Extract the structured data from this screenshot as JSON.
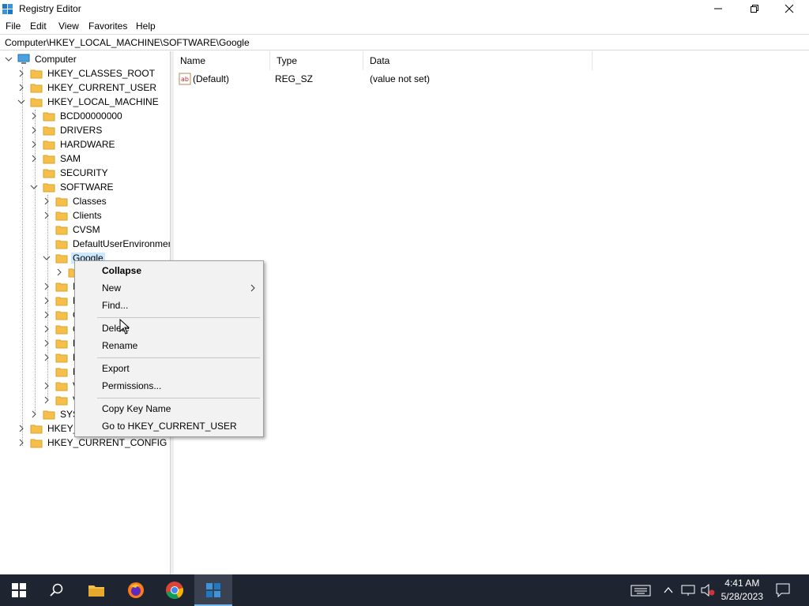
{
  "window": {
    "title": "Registry Editor"
  },
  "menu": [
    "File",
    "Edit",
    "View",
    "Favorites",
    "Help"
  ],
  "address": "Computer\\HKEY_LOCAL_MACHINE\\SOFTWARE\\Google",
  "tree": {
    "root": "Computer",
    "hkcr": "HKEY_CLASSES_ROOT",
    "hkcu": "HKEY_CURRENT_USER",
    "hklm": "HKEY_LOCAL_MACHINE",
    "hklm_children": [
      "BCD00000000",
      "DRIVERS",
      "HARDWARE",
      "SAM",
      "SECURITY",
      "SOFTWARE"
    ],
    "software_children": [
      "Classes",
      "Clients",
      "CVSM",
      "DefaultUserEnvironmen",
      "Google"
    ],
    "partial_children": [
      "I",
      "M",
      "O",
      "O",
      "P",
      "P",
      "R",
      "V",
      "V"
    ],
    "system_partial": "SYST",
    "hku_partial": "HKEY_U",
    "hkcc": "HKEY_CURRENT_CONFIG"
  },
  "list": {
    "columns": [
      "Name",
      "Type",
      "Data"
    ],
    "rows": [
      {
        "name": "(Default)",
        "type": "REG_SZ",
        "data": "(value not set)"
      }
    ]
  },
  "context_menu": {
    "items": [
      "Collapse",
      "New",
      "Find...",
      "Delete",
      "Rename",
      "Export",
      "Permissions...",
      "Copy Key Name",
      "Go to HKEY_CURRENT_USER"
    ]
  },
  "taskbar": {
    "time": "4:41 AM",
    "date": "5/28/2023"
  },
  "colors": {
    "selection": "#cce8ff",
    "taskbar": "#1f2530",
    "folder": "#f5c04a"
  }
}
